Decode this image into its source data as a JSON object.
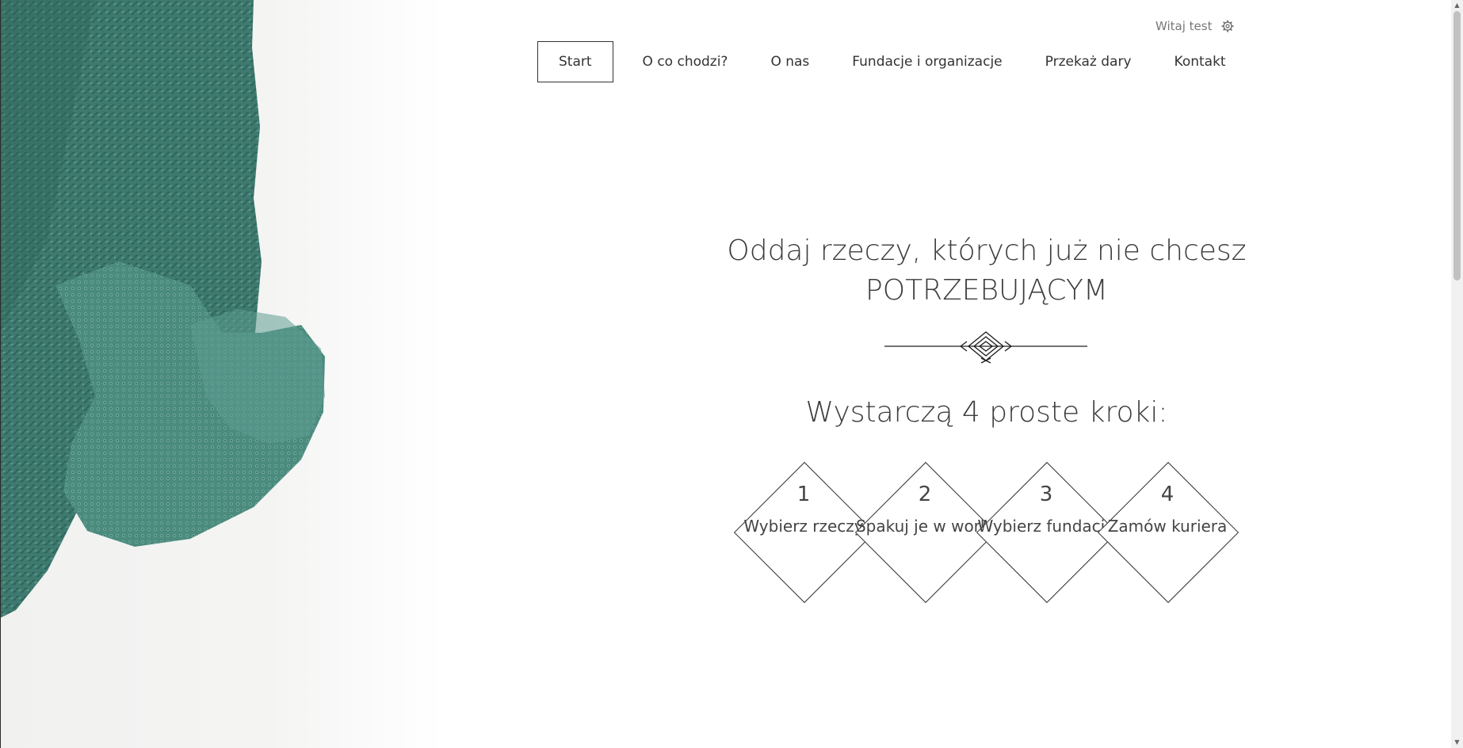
{
  "user": {
    "greeting": "Witaj test",
    "settings_icon": "gear-icon"
  },
  "nav": {
    "items": [
      {
        "label": "Start",
        "active": true
      },
      {
        "label": "O co chodzi?"
      },
      {
        "label": "O nas"
      },
      {
        "label": "Fundacje i organizacje"
      },
      {
        "label": "Przekaż dary"
      },
      {
        "label": "Kontakt"
      }
    ]
  },
  "hero": {
    "line1": "Oddaj rzeczy, których już nie chcesz",
    "line2": "POTRZEBUJĄCYM"
  },
  "steps": {
    "title": "Wystarczą 4 proste kroki:",
    "items": [
      {
        "num": "1",
        "label": "Wybierz rzeczy"
      },
      {
        "num": "2",
        "label": "Spakuj je w worki"
      },
      {
        "num": "3",
        "label": "Wybierz fundację"
      },
      {
        "num": "4",
        "label": "Zamów kuriera"
      }
    ]
  },
  "colors": {
    "sweater": "#3f7f73",
    "text": "#3c3c3c"
  }
}
